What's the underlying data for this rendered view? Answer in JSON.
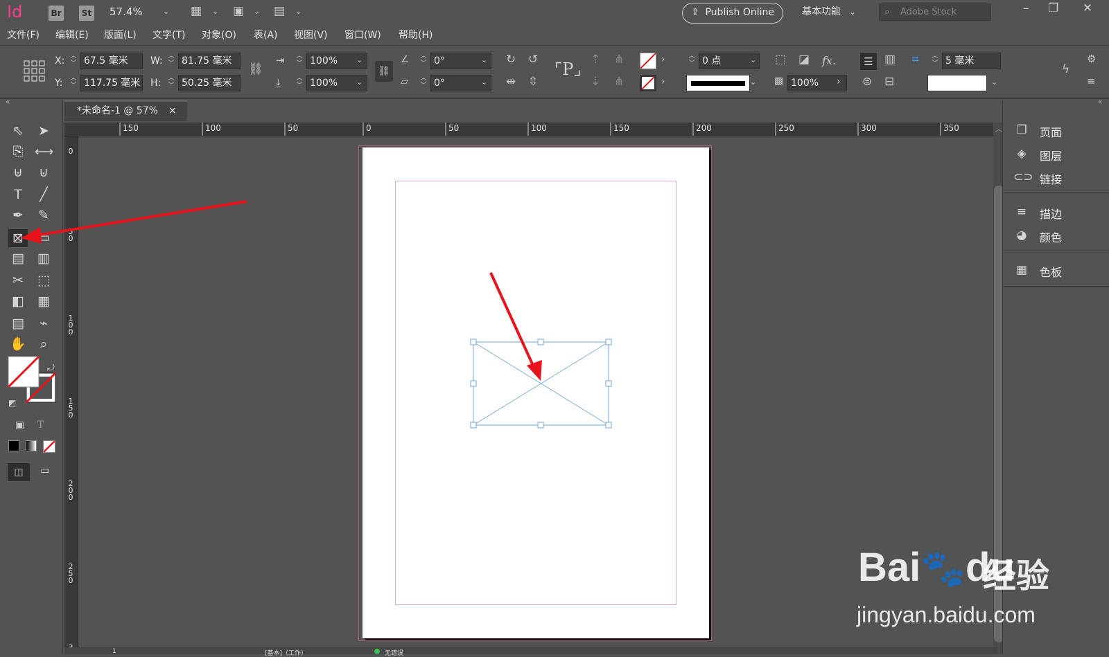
{
  "app": {
    "logo": "Id",
    "bridge": "Br",
    "stock_app": "St",
    "zoom": "57.4%"
  },
  "publish": "Publish Online",
  "workspace": "基本功能",
  "search_placeholder": "Adobe Stock",
  "menu": [
    "文件(F)",
    "编辑(E)",
    "版面(L)",
    "文字(T)",
    "对象(O)",
    "表(A)",
    "视图(V)",
    "窗口(W)",
    "帮助(H)"
  ],
  "control": {
    "x_label": "X:",
    "x": "67.5 毫米",
    "y_label": "Y:",
    "y": "117.75 毫米",
    "w_label": "W:",
    "w": "81.75 毫米",
    "h_label": "H:",
    "h": "50.25 毫米",
    "scale_x": "100%",
    "scale_y": "100%",
    "rotate": "0°",
    "shear": "0°",
    "stroke_weight": "0 点",
    "opacity": "100%",
    "gap": "5 毫米"
  },
  "tab": {
    "title": "*未命名-1 @ 57%",
    "close": "×"
  },
  "ruler_h": [
    "150",
    "100",
    "50",
    "0",
    "50",
    "100",
    "150",
    "200",
    "250",
    "300",
    "350"
  ],
  "ruler_v": [
    "0",
    "5\n0",
    "1\n0\n0",
    "1\n5\n0",
    "2\n0\n0",
    "2\n5\n0",
    "3"
  ],
  "panels": [
    "页面",
    "图层",
    "链接",
    "描边",
    "颜色",
    "色板"
  ],
  "status": {
    "page": "1",
    "mode": "[基本]（工作）",
    "preflight": "无错误"
  },
  "watermark": {
    "brand": "Bai",
    "brand2": "du",
    "cjk": "经验",
    "url": "jingyan.baidu.com"
  },
  "colors": {
    "accent": "#ff3d8a",
    "arrow": "#e8141c",
    "frame": "#6ea6d8"
  }
}
